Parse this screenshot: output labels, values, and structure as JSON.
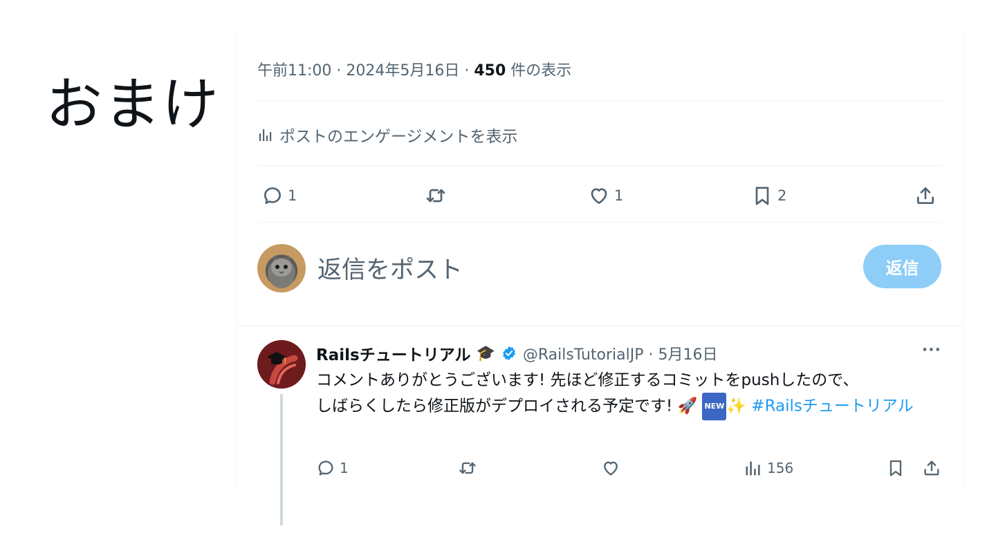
{
  "slide": {
    "title": "おまけ"
  },
  "post": {
    "meta_time": "午前11:00 · 2024年5月16日 · ",
    "meta_views_count": "450",
    "meta_views_label": " 件の表示",
    "engagement_link": "ポストのエンゲージメントを表示",
    "actions": {
      "reply_count": "1",
      "repost_count": "",
      "like_count": "1",
      "bookmark_count": "2"
    }
  },
  "compose": {
    "placeholder": "返信をポスト",
    "button_label": "返信"
  },
  "reply": {
    "author_name": "Railsチュートリアル",
    "author_emoji": "🎓",
    "handle_date": "@RailsTutorialJP · 5月16日",
    "more": "···",
    "text_line1": "コメントありがとうございます! 先ほど修正するコミットをpushしたので、",
    "text_line2": "しばらくしたら修正版がデプロイされる予定です! 🚀",
    "new_badge": "NEW",
    "sparkle": "✨",
    "hashtag": " #Railsチュートリアル",
    "actions": {
      "reply_count": "1",
      "repost_count": "",
      "like_count": "",
      "views_count": "156"
    }
  },
  "colors": {
    "accent": "#1d9bf0",
    "reply_button_disabled": "#8ecdf8",
    "secondary_text": "#536471",
    "divider": "#eff3f4",
    "verified": "#1d9bf0"
  }
}
